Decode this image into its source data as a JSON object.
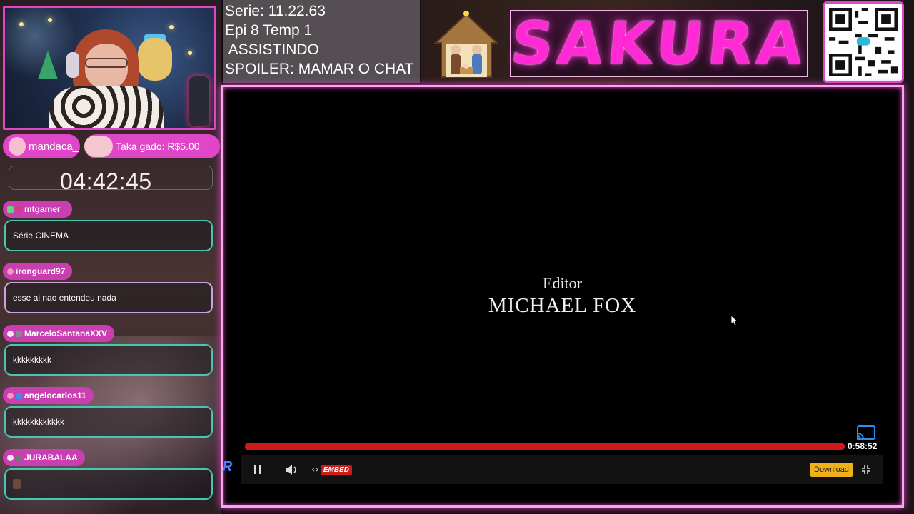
{
  "stream": {
    "info_lines": [
      "Serie: 11.22.63",
      "Epi 8 Temp 1",
      " ASSISTINDO",
      "SPOILER: MAMAR O CHAT"
    ],
    "logo_text": "SAKURA",
    "timer": "04:42:45",
    "alerts": [
      {
        "user": "mandaca_"
      },
      {
        "text": "Taka gado: R$5.00"
      }
    ]
  },
  "chat": [
    {
      "user": "mtgamer_",
      "message": "Série CINEMA",
      "style": "teal"
    },
    {
      "user": "ironguard97",
      "message": "esse ai nao entendeu nada",
      "style": "pink"
    },
    {
      "user": "MarceloSantanaXXV",
      "message": "kkkkkkkkk",
      "style": "teal"
    },
    {
      "user": "angelocarlos11",
      "message": "kkkkkkkkkkkk",
      "style": "teal"
    },
    {
      "user": "JURABALAA",
      "message": "",
      "style": "teal"
    }
  ],
  "player": {
    "credit_role": "Editor",
    "credit_name": "MICHAEL FOX",
    "elapsed": "0:58:52",
    "progress_fraction": 0.99,
    "embed_label": "EMBED",
    "download_label": "Download",
    "icons": [
      "pause-icon",
      "volume-icon",
      "cast-icon",
      "fullscreen-exit-icon"
    ]
  },
  "colors": {
    "accent": "#e046c8",
    "chat_border": "#47c6b4",
    "progress": "#cd1b1b",
    "download": "#efb018"
  }
}
